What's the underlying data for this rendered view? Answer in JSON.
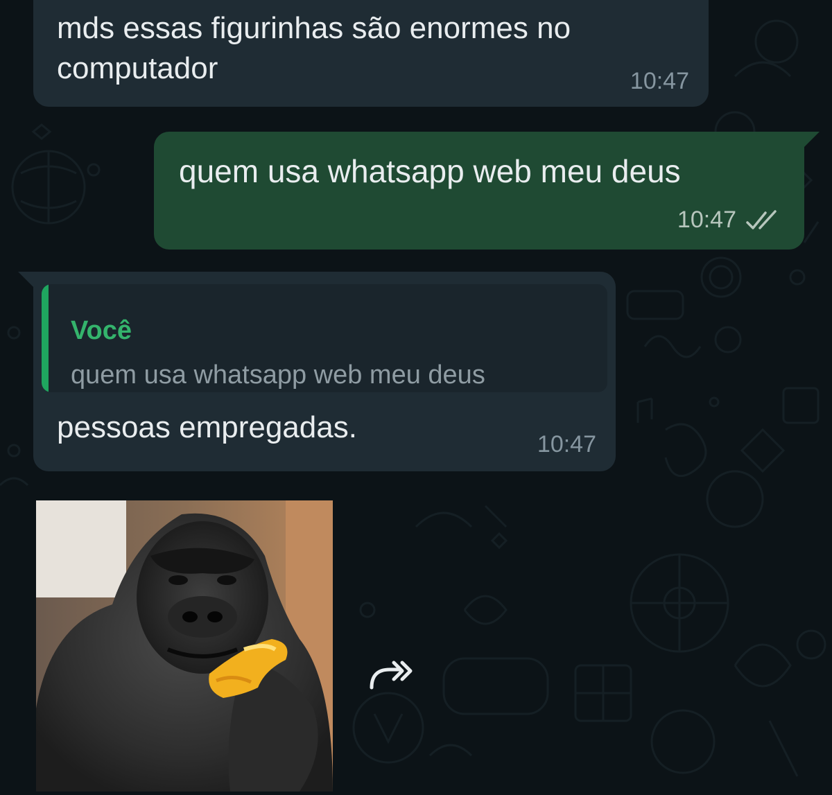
{
  "messages": [
    {
      "direction": "incoming",
      "text": "mds essas figurinhas são enormes no computador",
      "time": "10:47"
    },
    {
      "direction": "outgoing",
      "text": "quem usa whatsapp web meu deus",
      "time": "10:47",
      "status": "read"
    },
    {
      "direction": "incoming",
      "reply": {
        "author": "Você",
        "text": "quem usa whatsapp web meu deus"
      },
      "text": "pessoas empregadas.",
      "time": "10:47"
    }
  ],
  "sticker": {
    "kind": "gorilla-eating-sticker"
  },
  "icons": {
    "read_receipt": "double-check-icon",
    "forward": "forward-share-icon"
  },
  "colors": {
    "background": "#0c1317",
    "incoming_bubble": "#1f2c34",
    "outgoing_bubble": "#1f4a33",
    "reply_accent": "#1fa55f",
    "text": "#e9edef",
    "meta_text": "#8696a0"
  }
}
